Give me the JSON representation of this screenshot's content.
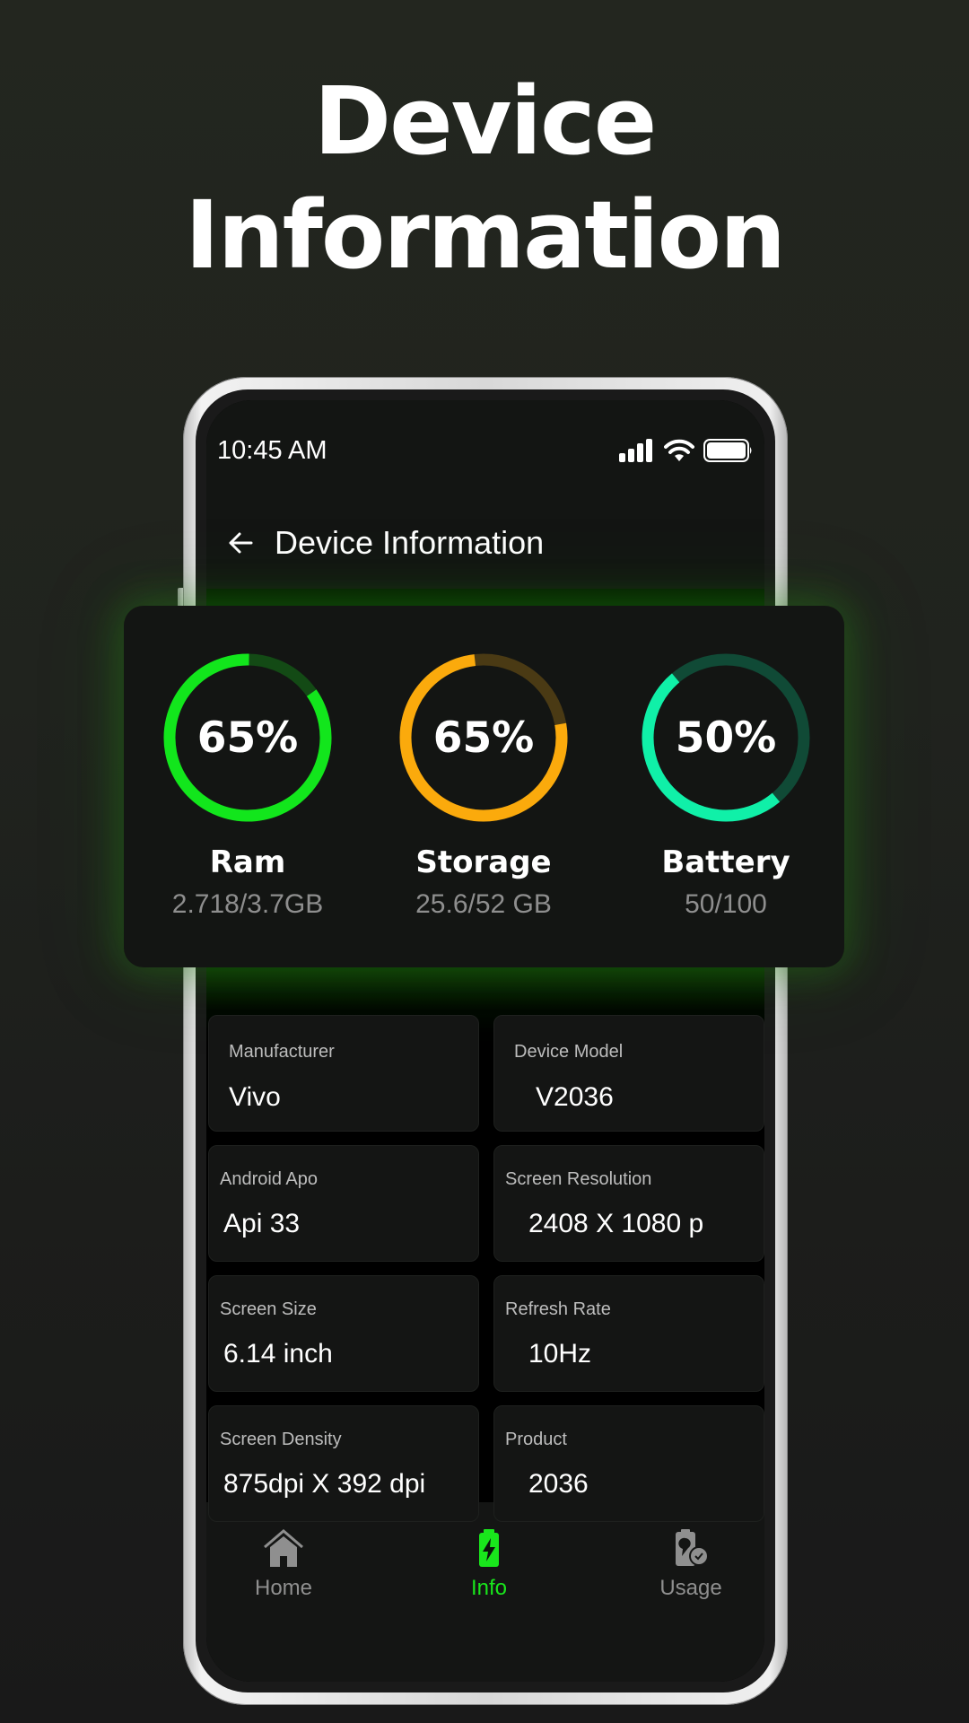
{
  "headline": {
    "line1": "Device",
    "line2": "Information"
  },
  "status_bar": {
    "time": "10:45 AM",
    "icons": [
      "signal-icon",
      "wifi-icon",
      "battery-icon"
    ]
  },
  "app_bar": {
    "back_icon": "arrow-left-icon",
    "title": "Device Information"
  },
  "stats": [
    {
      "name": "ram",
      "percent_label": "65%",
      "label": "Ram",
      "detail": "2.718/3.7GB",
      "ring_fill_fraction": 0.85,
      "color": "#12e61c",
      "track_color": "#134a15"
    },
    {
      "name": "storage",
      "percent_label": "65%",
      "label": "Storage",
      "detail": "25.6/52 GB",
      "ring_fill_fraction": 0.76,
      "color": "#fbaa0c",
      "track_color": "#4a3a14"
    },
    {
      "name": "battery",
      "percent_label": "50%",
      "label": "Battery",
      "detail": "50/100",
      "ring_fill_fraction": 0.5,
      "color": "#10f0a8",
      "track_color": "#104a36"
    }
  ],
  "info_cards": [
    {
      "label": "Manufacturer",
      "value": "Vivo"
    },
    {
      "label": "Device Model",
      "value": "V2036"
    },
    {
      "label": "Android Apo",
      "value": "Api 33"
    },
    {
      "label": "Screen Resolution",
      "value": "2408 X 1080 p"
    },
    {
      "label": "Screen Size",
      "value": "6.14 inch"
    },
    {
      "label": "Refresh Rate",
      "value": "10Hz"
    },
    {
      "label": "Screen Density",
      "value": "875dpi X 392 dpi"
    },
    {
      "label": "Product",
      "value": "2036"
    }
  ],
  "bottom_nav": [
    {
      "label": "Home",
      "icon": "home-icon",
      "active": false
    },
    {
      "label": "Info",
      "icon": "battery-charging-icon",
      "active": true
    },
    {
      "label": "Usage",
      "icon": "battery-usage-clock-icon",
      "active": false
    }
  ],
  "colors": {
    "accent": "#19e61c",
    "inactive_nav": "#8f8f8f"
  }
}
